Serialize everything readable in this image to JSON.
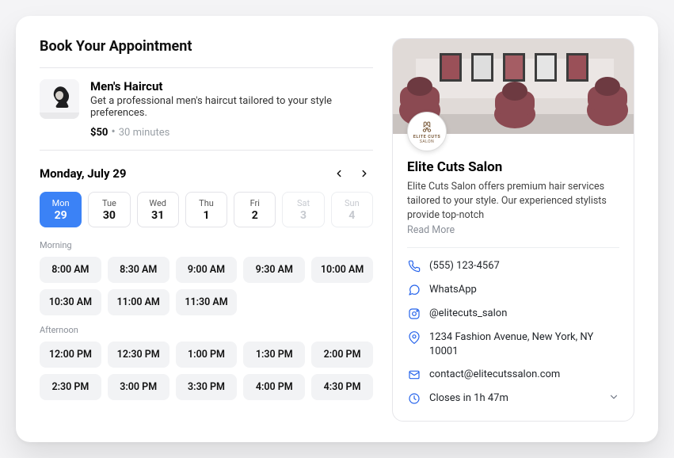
{
  "header": {
    "title": "Book Your Appointment"
  },
  "service": {
    "title": "Men's Haircut",
    "description": "Get a professional men's haircut tailored to your style preferences.",
    "price": "$50",
    "sep": " • ",
    "duration": "30 minutes"
  },
  "calendar": {
    "current_date": "Monday, July 29",
    "days": [
      {
        "dow": "Mon",
        "num": "29",
        "state": "selected"
      },
      {
        "dow": "Tue",
        "num": "30",
        "state": "normal"
      },
      {
        "dow": "Wed",
        "num": "31",
        "state": "normal"
      },
      {
        "dow": "Thu",
        "num": "1",
        "state": "normal"
      },
      {
        "dow": "Fri",
        "num": "2",
        "state": "normal"
      },
      {
        "dow": "Sat",
        "num": "3",
        "state": "disabled"
      },
      {
        "dow": "Sun",
        "num": "4",
        "state": "disabled"
      }
    ],
    "sections": [
      {
        "title": "Morning",
        "slots": [
          "8:00 AM",
          "8:30 AM",
          "9:00 AM",
          "9:30 AM",
          "10:00 AM",
          "10:30 AM",
          "11:00 AM",
          "11:30 AM"
        ]
      },
      {
        "title": "Afternoon",
        "slots": [
          "12:00 PM",
          "12:30 PM",
          "1:00 PM",
          "1:30 PM",
          "2:00 PM",
          "2:30 PM",
          "3:00 PM",
          "3:30 PM",
          "4:00 PM",
          "4:30 PM"
        ]
      }
    ]
  },
  "business": {
    "name": "Elite Cuts Salon",
    "logo_text": "ELITE CUTS",
    "logo_sub": "SALON",
    "description": "Elite Cuts Salon offers premium hair services tailored to your style. Our experienced stylists provide top-notch",
    "read_more": "Read More",
    "contact": {
      "phone": "(555) 123-4567",
      "whatsapp": "WhatsApp",
      "instagram": "@elitecuts_salon",
      "address": "1234 Fashion Avenue, New York, NY 10001",
      "email": "contact@elitecutssalon.com",
      "hours": "Closes in 1h 47m"
    }
  }
}
